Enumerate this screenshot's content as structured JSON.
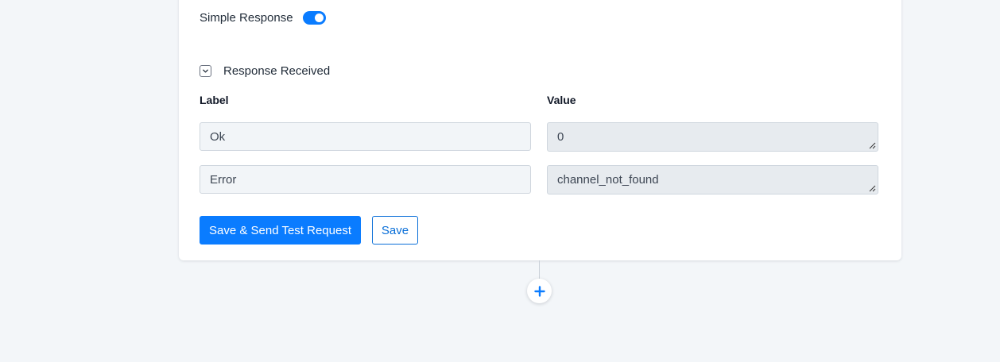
{
  "settings": {
    "simple_response_label": "Simple Response",
    "simple_response_enabled": true,
    "response_received_label": "Response Received"
  },
  "table": {
    "label_header": "Label",
    "value_header": "Value",
    "rows": [
      {
        "label": "Ok",
        "value": "0"
      },
      {
        "label": "Error",
        "value": "channel_not_found"
      }
    ]
  },
  "actions": {
    "save_send_label": "Save & Send Test Request",
    "save_label": "Save"
  },
  "colors": {
    "accent": "#0a7cff",
    "page_background": "#f3f6f9"
  },
  "icons": {
    "add_step": "plus-icon",
    "expand": "chevron-down-icon",
    "resize": "resize-handle-icon"
  }
}
